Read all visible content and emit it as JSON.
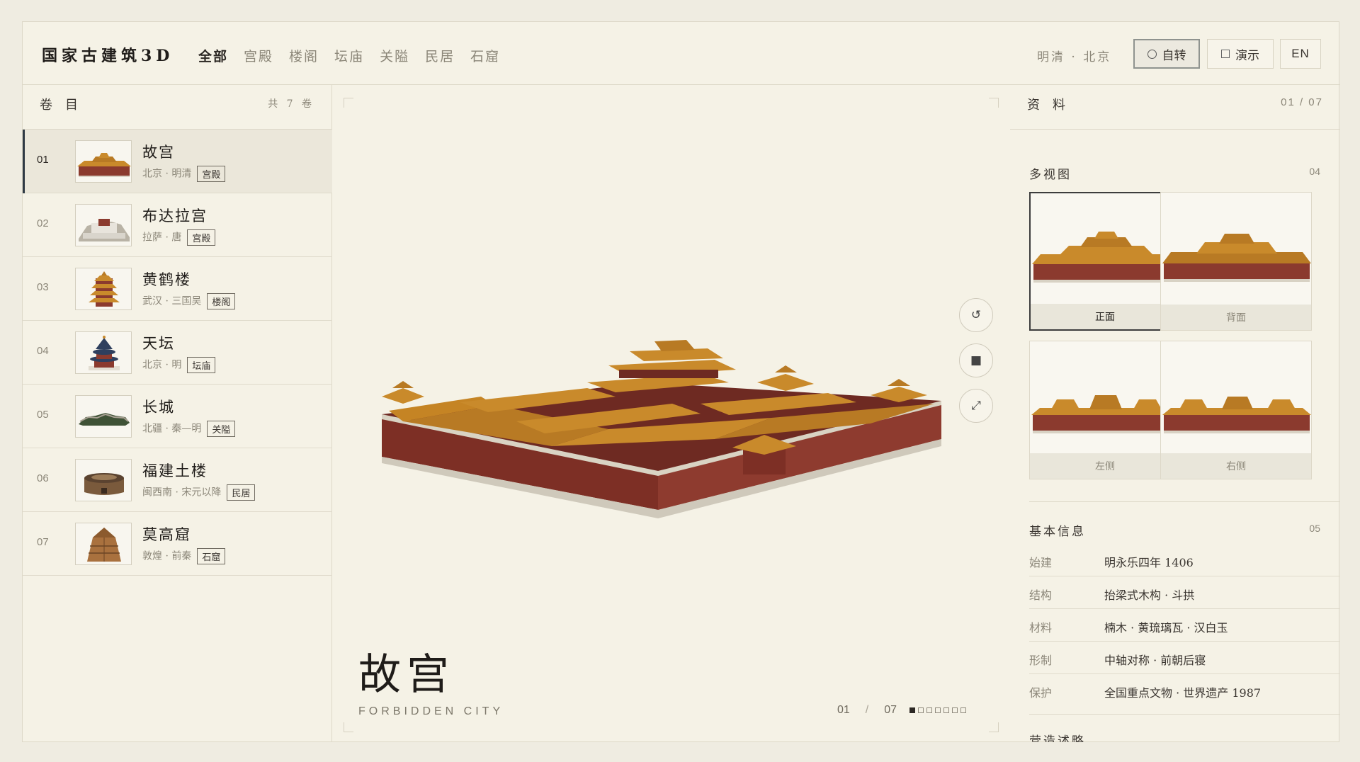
{
  "header": {
    "brand": "国家古建筑3D",
    "nav": [
      "全部",
      "宫殿",
      "楼阁",
      "坛庙",
      "关隘",
      "民居",
      "石窟"
    ],
    "location": "明清 · 北京",
    "autorotate_label": "自转",
    "demo_label": "演示",
    "lang_label": "EN"
  },
  "sidebar": {
    "title": "卷目",
    "count": "共 7 卷",
    "items": [
      {
        "num": "01",
        "title": "故宫",
        "sub": "北京 · 明清",
        "tag": "宫殿"
      },
      {
        "num": "02",
        "title": "布达拉宫",
        "sub": "拉萨 · 唐",
        "tag": "宫殿"
      },
      {
        "num": "03",
        "title": "黄鹤楼",
        "sub": "武汉 · 三国吴",
        "tag": "楼阁"
      },
      {
        "num": "04",
        "title": "天坛",
        "sub": "北京 · 明",
        "tag": "坛庙"
      },
      {
        "num": "05",
        "title": "长城",
        "sub": "北疆 · 秦—明",
        "tag": "关隘"
      },
      {
        "num": "06",
        "title": "福建土楼",
        "sub": "闽西南 · 宋元以降",
        "tag": "民居"
      },
      {
        "num": "07",
        "title": "莫高窟",
        "sub": "敦煌 · 前秦",
        "tag": "石窟"
      }
    ]
  },
  "viewer": {
    "title": "故宫",
    "subtitle": "FORBIDDEN CITY",
    "page_current": "01",
    "page_total": "07",
    "page_dots": 7,
    "page_active_index": 0
  },
  "panel": {
    "title": "资料",
    "page": "01 / 07",
    "views_title": "多视图",
    "views_num": "04",
    "views": [
      "正面",
      "背面",
      "左侧",
      "右侧"
    ],
    "info_title": "基本信息",
    "info_num": "05",
    "info": [
      {
        "k": "始建",
        "v": "明永乐四年 1406"
      },
      {
        "k": "结构",
        "v": "抬梁式木构 · 斗拱"
      },
      {
        "k": "材料",
        "v": "楠木 · 黄琉璃瓦 · 汉白玉"
      },
      {
        "k": "形制",
        "v": "中轴对称 · 前朝后寝"
      },
      {
        "k": "保护",
        "v": "全国重点文物 · 世界遗产 1987"
      }
    ],
    "next_section": "营造述略"
  },
  "colors": {
    "background": "#f5f2e6",
    "accent": "#2f3a44",
    "wall_red": "#8b3a2e",
    "roof_gold": "#c98a2b"
  }
}
